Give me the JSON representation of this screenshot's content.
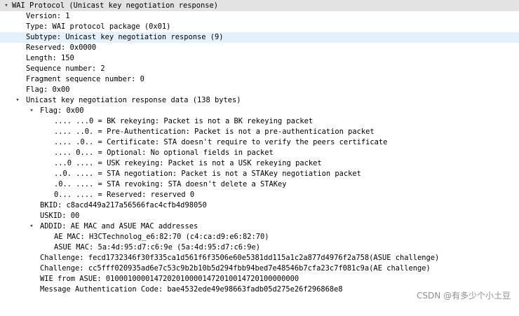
{
  "tree": {
    "root": {
      "label": "WAI Protocol (Unicast key negotiation response)",
      "expanded_icon": "▾"
    },
    "fields": {
      "version": "Version: 1",
      "type": "Type: WAI protocol package (0x01)",
      "subtype": "Subtype: Unicast key negotiation response (9)",
      "reserved": "Reserved: 0x0000",
      "length": "Length: 150",
      "sequence_number": "Sequence number: 2",
      "fragment_sequence_number": "Fragment sequence number: 0",
      "flag": "Flag: 0x00"
    },
    "response_data": {
      "label": "Unicast key negotiation response data (138 bytes)",
      "expanded_icon": "▾",
      "flag": {
        "label": "Flag: 0x00",
        "expanded_icon": "▾",
        "bits": [
          ".... ...0 = BK rekeying: Packet is not a BK rekeying packet",
          ".... ..0. = Pre-Authentication: Packet is not a pre-authentication packet",
          ".... .0.. = Certificate: STA doesn't require to verify the peers certificate",
          ".... 0... = Optional: No optional fields in packet",
          "...0 .... = USK rekeying: Packet is not a USK rekeying packet",
          "..0. .... = STA negotiation: Packet is not a STAKey negotiation packet",
          ".0.. .... = STA revoking: STA doesn't delete a STAKey",
          "0... .... = Reserved: reserved 0"
        ]
      },
      "bkid": "BKID: c8acd449a217a56566fac4cfb4d98050",
      "uskid": "USKID: 00",
      "addid": {
        "label": "ADDID: AE MAC and ASUE MAC addresses",
        "expanded_icon": "▾",
        "ae_mac": "AE MAC: H3CTechnolog_e6:82:70 (c4:ca:d9:e6:82:70)",
        "asue_mac": "ASUE MAC: 5a:4d:95:d7:c6:9e (5a:4d:95:d7:c6:9e)"
      },
      "challenge_asue": "Challenge: fecd1732346f30f335ca1d561f6f3506e60e5381dd115a1c2a877d4976f2a758(ASUE challenge)",
      "challenge_ae": "Challenge: cc5fff020935ad6e7c53c9b2b10b5d294fbb94bed7e48546b7cfa23c7f081c9a(AE challenge)",
      "wie_from_asue": "WIE from ASUE: 01000100001472020100001472010014720100000000",
      "mac_code": "Message Authentication Code: bae4532ede49e98663fadb05d275e26f296868e8"
    }
  },
  "watermark": "CSDN @有多少个小土豆"
}
